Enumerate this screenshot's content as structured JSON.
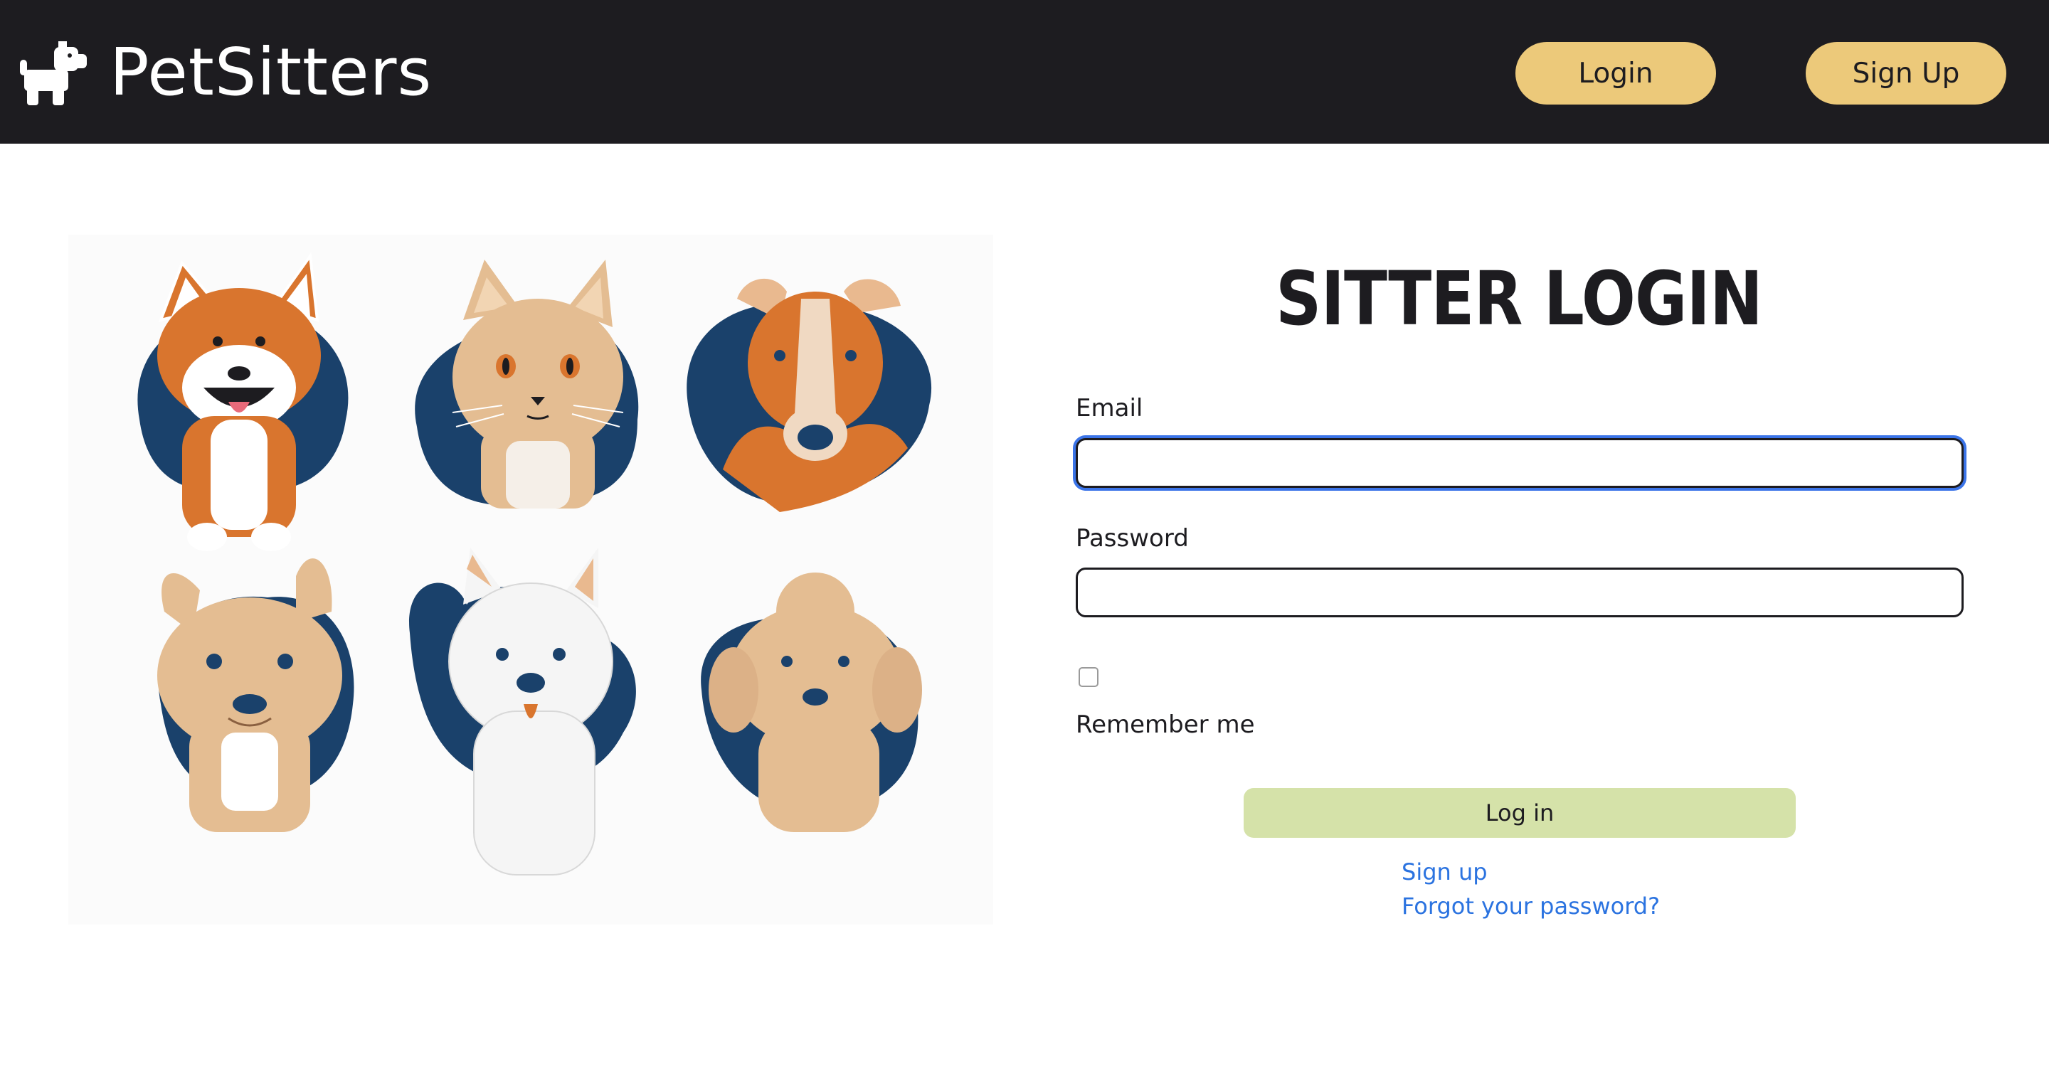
{
  "header": {
    "brand_name": "PetSitters",
    "brand_icon": "dog-icon",
    "login_label": "Login",
    "signup_label": "Sign Up"
  },
  "illustration": {
    "icons": [
      "corgi-icon",
      "cat-icon",
      "hound-icon",
      "french-bulldog-icon",
      "westie-icon",
      "poodle-icon"
    ]
  },
  "form": {
    "title": "SITTER LOGIN",
    "email_label": "Email",
    "password_label": "Password",
    "remember_label": "Remember me",
    "submit_label": "Log in",
    "signup_link": "Sign up",
    "forgot_link": "Forgot your password?"
  },
  "colors": {
    "header_bg": "#1d1c20",
    "nav_button": "#ecc97a",
    "submit_button": "#d5e2a9",
    "link": "#2b73e0",
    "blob": "#1a416b",
    "focus_ring": "#3b74e8"
  }
}
